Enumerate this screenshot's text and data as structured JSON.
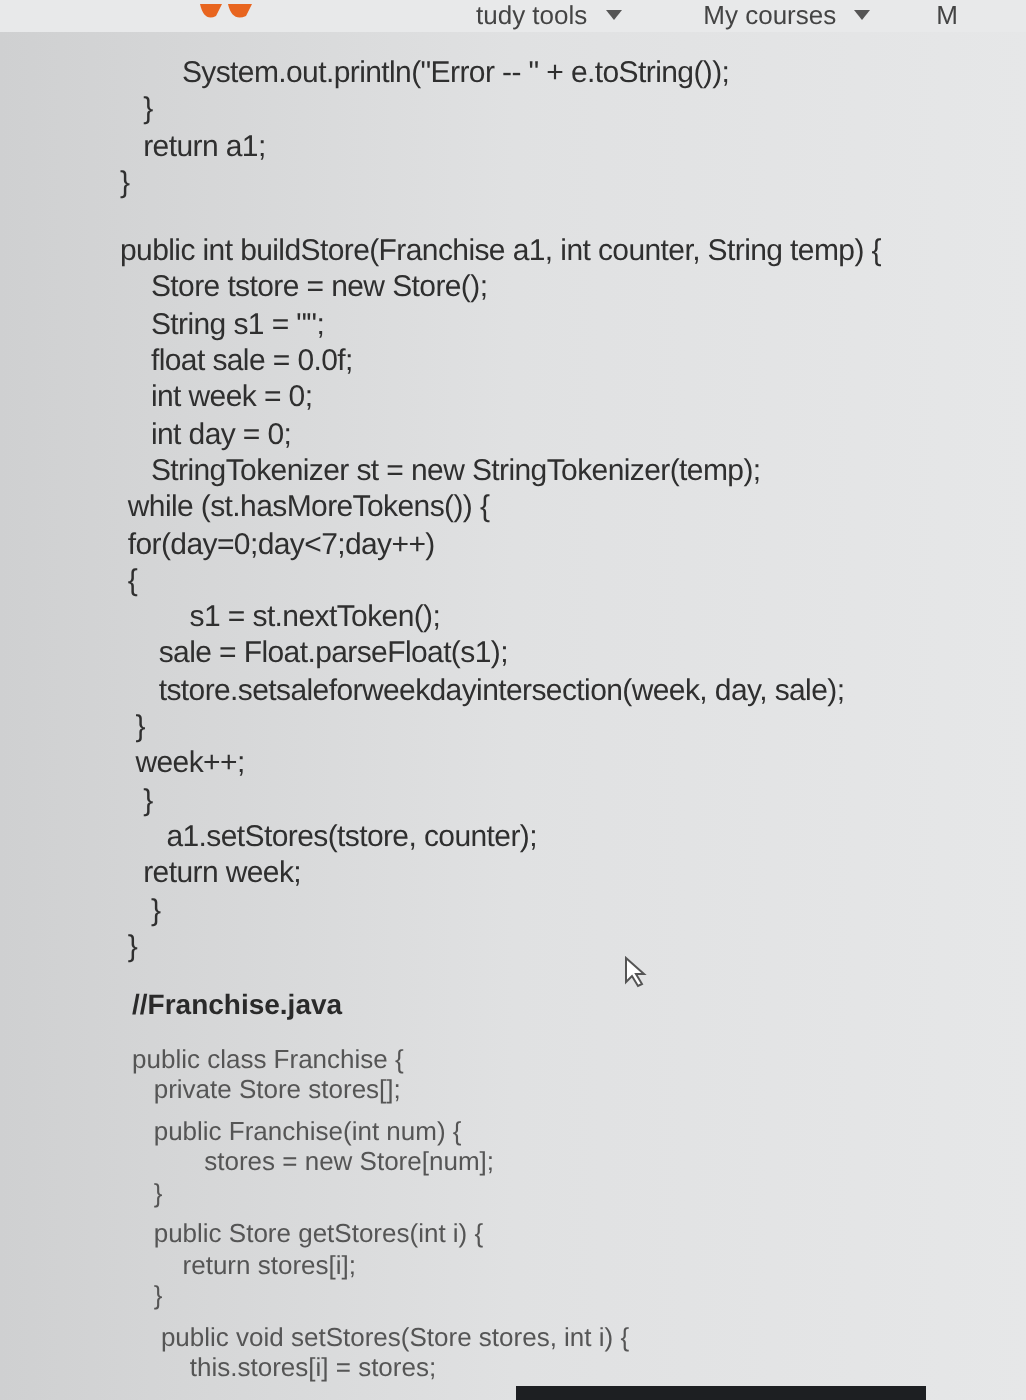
{
  "nav": {
    "items": [
      {
        "label": "tudy tools",
        "dropdown": true
      },
      {
        "label": "My courses",
        "dropdown": true
      },
      {
        "label": "M",
        "dropdown": false
      }
    ]
  },
  "code_blocks": [
    {
      "groups": [
        [
          "        System.out.println(\"Error -- \" + e.toString());",
          "   }",
          "   return a1;",
          "}"
        ],
        [
          "public int buildStore(Franchise a1, int counter, String temp) {",
          "    Store tstore = new Store();",
          "    String s1 = \"\";",
          "    float sale = 0.0f;",
          "    int week = 0;",
          "    int day = 0;",
          "    StringTokenizer st = new StringTokenizer(temp);",
          " while (st.hasMoreTokens()) {",
          " for(day=0;day<7;day++)",
          " {",
          "         s1 = st.nextToken();",
          "     sale = Float.parseFloat(s1);",
          "     tstore.setsaleforweekdayintersection(week, day, sale);",
          "  }",
          "  week++;",
          "   }",
          "      a1.setStores(tstore, counter);",
          "   return week;",
          "    }",
          " }"
        ]
      ]
    },
    {
      "heading": "//Franchise.java",
      "groups": [
        [
          "public class Franchise {",
          "   private Store stores[];"
        ],
        [
          "   public Franchise(int num) {",
          "          stores = new Store[num];",
          "   }"
        ],
        [
          "   public Store getStores(int i) {",
          "       return stores[i];",
          "   }"
        ],
        [
          "    public void setStores(Store stores, int i) {",
          "        this.stores[i] = stores;"
        ]
      ]
    }
  ]
}
